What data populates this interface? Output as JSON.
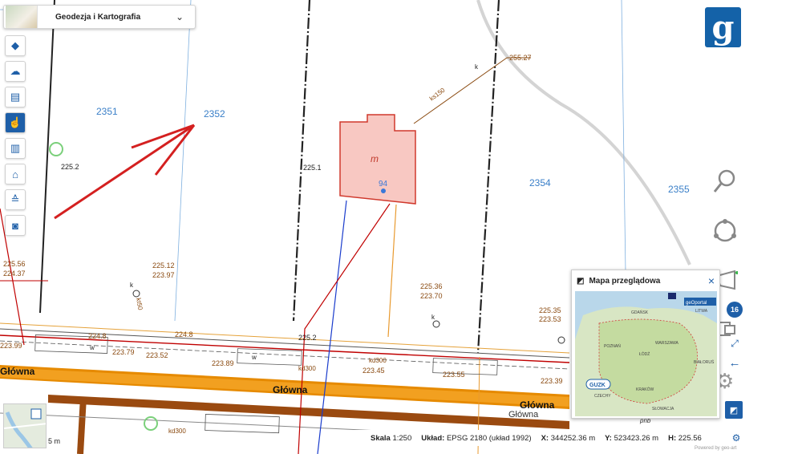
{
  "header": {
    "title": "Geodezja i Kartografia",
    "dropdown_icon": "chevron-down-icon"
  },
  "toolbar": {
    "items": [
      {
        "icon": "layers-icon",
        "glyph": "◆"
      },
      {
        "icon": "cloud-icon",
        "glyph": "☁"
      },
      {
        "icon": "print-icon",
        "glyph": "▤"
      },
      {
        "icon": "pointer-hand-icon",
        "glyph": "☝"
      },
      {
        "icon": "clipboard-icon",
        "glyph": "▥"
      },
      {
        "icon": "home-euro-icon",
        "glyph": "⌂"
      },
      {
        "icon": "sunrise-icon",
        "glyph": "≙"
      },
      {
        "icon": "camera-icon",
        "glyph": "◙"
      }
    ]
  },
  "logo": {
    "text": "g"
  },
  "map": {
    "parcels": [
      "2351",
      "2352",
      "2354",
      "2355"
    ],
    "building_label": "m",
    "building_number": "94",
    "heights": [
      "225.2",
      "225.1",
      "255.27",
      "225.12",
      "223.97",
      "225.36",
      "223.70",
      "225.35",
      "223.53",
      "225.56",
      "224.37",
      "223.99",
      "223.79",
      "223.52",
      "223.89",
      "223.45",
      "223.55",
      "223.39",
      "225.2",
      "224.8",
      "224.8"
    ],
    "street": "Główna",
    "street_small": "Główna",
    "labels_misc": [
      "k",
      "k",
      "k",
      "w",
      "w",
      "kd300",
      "kd300",
      "kd300",
      "kt50",
      "ks150",
      "pnb"
    ]
  },
  "overview": {
    "title": "Mapa przeglądowa",
    "close": "×",
    "brand": "geOportal",
    "badge": "GUZK",
    "region": "LITWA",
    "country_labels": [
      "WARSZAWA",
      "ŁÓDŹ",
      "POZNAŃ",
      "GDAŃSK",
      "KRAKÓW",
      "CZECHY",
      "BIAŁORUŚ",
      "SŁOWACJA"
    ]
  },
  "right_tools": {
    "count": "16"
  },
  "minimap": {
    "scale_label": "5 m"
  },
  "statusbar": {
    "scale_label": "Skala",
    "scale_value": "1:250",
    "system_label": "Układ:",
    "system_value": "EPSG 2180 (układ 1992)",
    "x_label": "X:",
    "x_value": "344252.36 m",
    "y_label": "Y:",
    "y_value": "523423.26 m",
    "h_label": "H:",
    "h_value": "225.56"
  },
  "powered": "Powered by geo-art",
  "colors": {
    "accent": "#1e5fa8",
    "building_fill": "#f8c8c2",
    "building_stroke": "#d0382c",
    "road": "#e68a00",
    "utility": "#c00000"
  }
}
